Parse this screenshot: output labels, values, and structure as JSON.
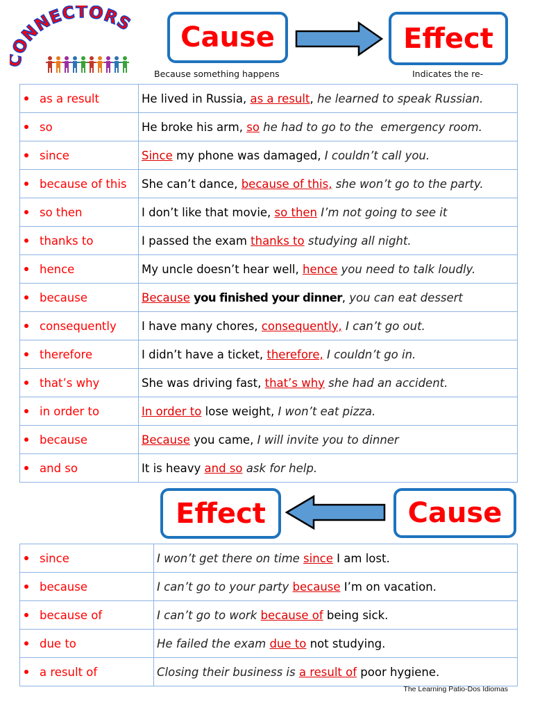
{
  "logo": {
    "title": "CONNECTORS",
    "people_colors": [
      "#c0392b",
      "#e67e22",
      "#9b2fa0",
      "#2e75b6",
      "#3aa33a",
      "#c0392b",
      "#e67e22",
      "#9b2fa0",
      "#2e75b6",
      "#3aa33a"
    ]
  },
  "header": {
    "cause_label": "Cause",
    "effect_label": "Effect",
    "cause_caption": "Because something happens",
    "effect_caption": "Indicates the re-"
  },
  "colors": {
    "accent_red": "#ff0000",
    "box_border": "#1e73be",
    "arrow_fill": "#5b9bd5",
    "table_border": "#8db3e2"
  },
  "cause_effect_table": [
    {
      "connector": "as a result",
      "segments": [
        {
          "t": "He lived in Russia, ",
          "s": "normal"
        },
        {
          "t": "as a result",
          "s": "conn"
        },
        {
          "t": ", ",
          "s": "normal"
        },
        {
          "t": "he learned to speak Russian.",
          "s": "ital"
        }
      ]
    },
    {
      "connector": "so",
      "segments": [
        {
          "t": "He broke his arm, ",
          "s": "normal"
        },
        {
          "t": "so",
          "s": "conn"
        },
        {
          "t": " he had to go to the  emergency room.",
          "s": "ital"
        }
      ]
    },
    {
      "connector": "since",
      "segments": [
        {
          "t": "Since",
          "s": "conn"
        },
        {
          "t": " my phone was damaged, ",
          "s": "normal"
        },
        {
          "t": "I couldn’t call you.",
          "s": "ital"
        }
      ]
    },
    {
      "connector": "because of this",
      "segments": [
        {
          "t": "She can’t dance, ",
          "s": "normal"
        },
        {
          "t": "because of this,",
          "s": "conn"
        },
        {
          "t": " she won’t go to the party.",
          "s": "ital"
        }
      ]
    },
    {
      "connector": "so then",
      "segments": [
        {
          "t": "I don’t like that movie, ",
          "s": "normal"
        },
        {
          "t": "so then",
          "s": "conn"
        },
        {
          "t": " I’m not going to see it",
          "s": "ital"
        }
      ]
    },
    {
      "connector": "thanks to",
      "segments": [
        {
          "t": "I passed the exam ",
          "s": "normal"
        },
        {
          "t": "thanks to",
          "s": "conn"
        },
        {
          "t": " studying all night.",
          "s": "ital"
        }
      ]
    },
    {
      "connector": "hence",
      "segments": [
        {
          "t": "My uncle doesn’t hear well, ",
          "s": "normal"
        },
        {
          "t": "hence",
          "s": "conn"
        },
        {
          "t": " you need to talk loudly.",
          "s": "ital"
        }
      ]
    },
    {
      "connector": "because",
      "segments": [
        {
          "t": "Because",
          "s": "conn"
        },
        {
          "t": " you finished your dinner",
          "s": "bold"
        },
        {
          "t": ", ",
          "s": "normal"
        },
        {
          "t": "you can eat dessert",
          "s": "ital"
        }
      ]
    },
    {
      "connector": "consequently",
      "segments": [
        {
          "t": "I have many chores, ",
          "s": "normal"
        },
        {
          "t": "consequently,",
          "s": "conn"
        },
        {
          "t": " I can’t go out.",
          "s": "ital"
        }
      ]
    },
    {
      "connector": "therefore",
      "segments": [
        {
          "t": "I didn’t have a ticket, ",
          "s": "normal"
        },
        {
          "t": "therefore,",
          "s": "conn"
        },
        {
          "t": " I couldn’t go in.",
          "s": "ital"
        }
      ]
    },
    {
      "connector": "that’s why",
      "segments": [
        {
          "t": "She was driving fast, ",
          "s": "normal"
        },
        {
          "t": "that’s why",
          "s": "conn"
        },
        {
          "t": " she had an accident.",
          "s": "ital"
        }
      ]
    },
    {
      "connector": "in order to",
      "segments": [
        {
          "t": "In order to",
          "s": "conn"
        },
        {
          "t": " lose weight, ",
          "s": "normal"
        },
        {
          "t": "I won’t eat pizza.",
          "s": "ital"
        }
      ]
    },
    {
      "connector": "because",
      "segments": [
        {
          "t": "Because",
          "s": "conn"
        },
        {
          "t": " you came, ",
          "s": "normal"
        },
        {
          "t": "I will invite you to dinner",
          "s": "ital"
        }
      ]
    },
    {
      "connector": "and so",
      "segments": [
        {
          "t": "It is heavy ",
          "s": "normal"
        },
        {
          "t": "and so",
          "s": "conn"
        },
        {
          "t": " ask for help.",
          "s": "ital"
        }
      ]
    }
  ],
  "effect_cause_table": [
    {
      "connector": "since",
      "segments": [
        {
          "t": "I won’t get there on time ",
          "s": "ital"
        },
        {
          "t": "since",
          "s": "conn"
        },
        {
          "t": " I am lost.",
          "s": "normal"
        }
      ]
    },
    {
      "connector": "because",
      "segments": [
        {
          "t": "I can’t go to your party ",
          "s": "ital"
        },
        {
          "t": "because",
          "s": "conn"
        },
        {
          "t": " I’m on vacation.",
          "s": "normal"
        }
      ]
    },
    {
      "connector": "because of",
      "segments": [
        {
          "t": "I can’t go to work ",
          "s": "ital"
        },
        {
          "t": "because of",
          "s": "conn"
        },
        {
          "t": " being sick.",
          "s": "normal"
        }
      ]
    },
    {
      "connector": "due to",
      "segments": [
        {
          "t": "He failed the exam ",
          "s": "ital"
        },
        {
          "t": "due to",
          "s": "conn"
        },
        {
          "t": " not studying.",
          "s": "normal"
        }
      ]
    },
    {
      "connector": "a result of",
      "segments": [
        {
          "t": "Closing their business is ",
          "s": "ital"
        },
        {
          "t": "a result of",
          "s": "conn"
        },
        {
          "t": " poor hygiene.",
          "s": "normal"
        }
      ]
    }
  ],
  "footer": "The  Learning Patio-Dos Idiomas"
}
